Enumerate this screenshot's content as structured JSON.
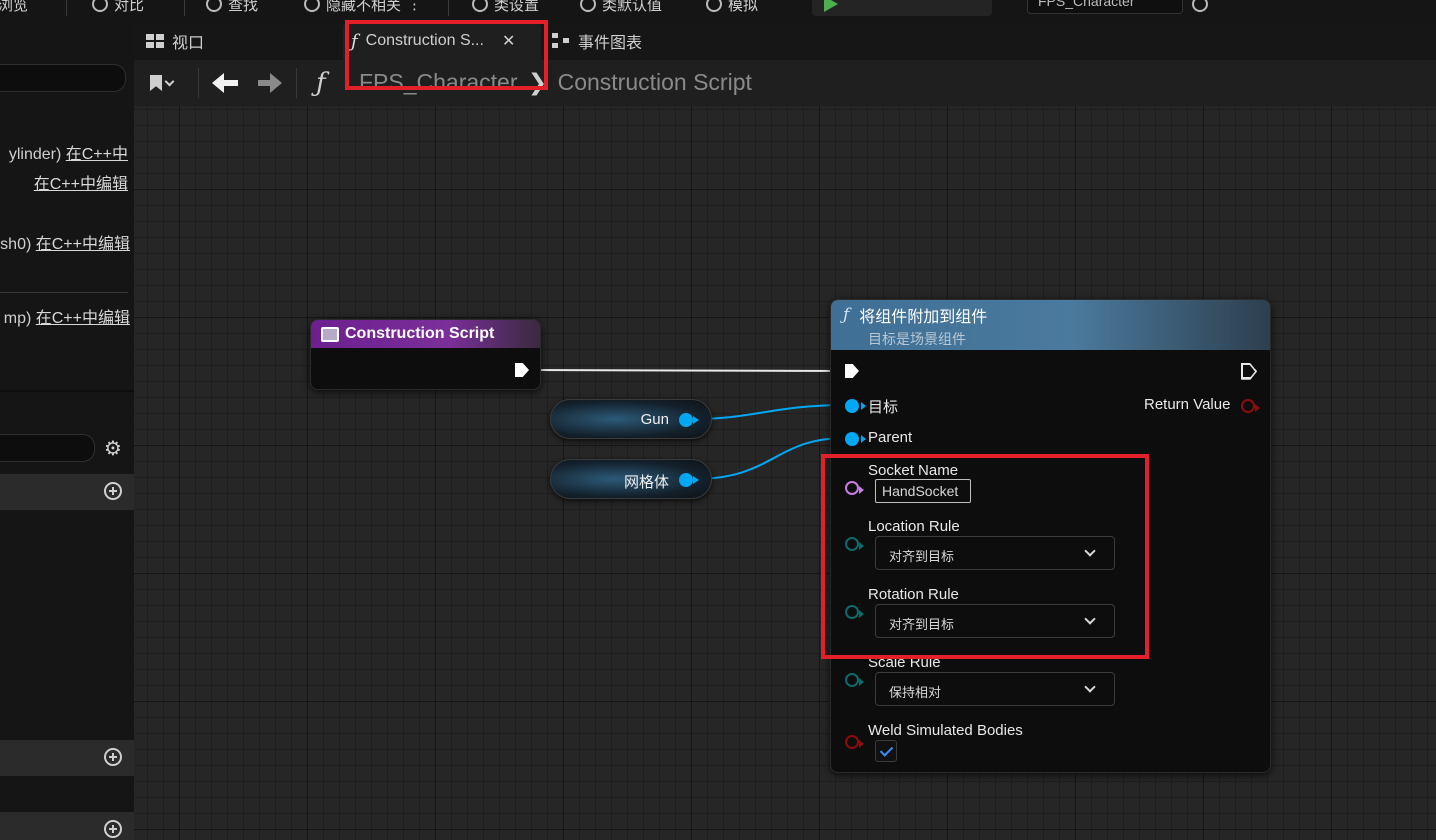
{
  "topbar": {
    "items": [
      "浏览",
      "对比",
      "查找",
      "隐藏不相关",
      "类设置",
      "类默认值",
      "模拟"
    ],
    "character_select": "FPS_Character"
  },
  "tabs": [
    {
      "label": "视口",
      "icon": "viewport-grid-icon"
    },
    {
      "label": "Construction S...",
      "icon": "function-icon",
      "active": true
    },
    {
      "label": "事件图表",
      "icon": "event-graph-icon"
    }
  ],
  "breadcrumb": {
    "parts": [
      "FPS_Character",
      "Construction Script"
    ],
    "separator": "❯"
  },
  "left_panel": {
    "rows": [
      {
        "prefix": "ylinder)",
        "link": "在C++中"
      },
      {
        "prefix": "",
        "link": "在C++中编辑"
      },
      {
        "prefix": "sh0)",
        "link": "在C++中编辑"
      },
      {
        "prefix": "mp)",
        "link": "在C++中编辑"
      }
    ]
  },
  "nodes": {
    "construction_script": {
      "title": "Construction Script"
    },
    "gun": {
      "label": "Gun"
    },
    "mesh": {
      "label": "网格体"
    },
    "attach": {
      "title": "将组件附加到组件",
      "subtitle": "目标是场景组件",
      "pins": {
        "target": "目标",
        "parent": "Parent",
        "return_value": "Return Value",
        "socket_name": "Socket Name",
        "socket_value": "HandSocket",
        "location_rule": "Location Rule",
        "location_value": "对齐到目标",
        "rotation_rule": "Rotation Rule",
        "rotation_value": "对齐到目标",
        "scale_rule": "Scale Rule",
        "scale_value": "保持相对",
        "weld": "Weld Simulated Bodies",
        "weld_checked": true
      }
    }
  },
  "colors": {
    "highlight": "#e3202a",
    "object_pin": "#00a8f3",
    "name_pin": "#c77de6",
    "enum_pin": "#0a6b6b",
    "bool_pin": "#8f0b0b",
    "construction_header": "#6d1f8f",
    "function_header": "#3f6f95"
  }
}
